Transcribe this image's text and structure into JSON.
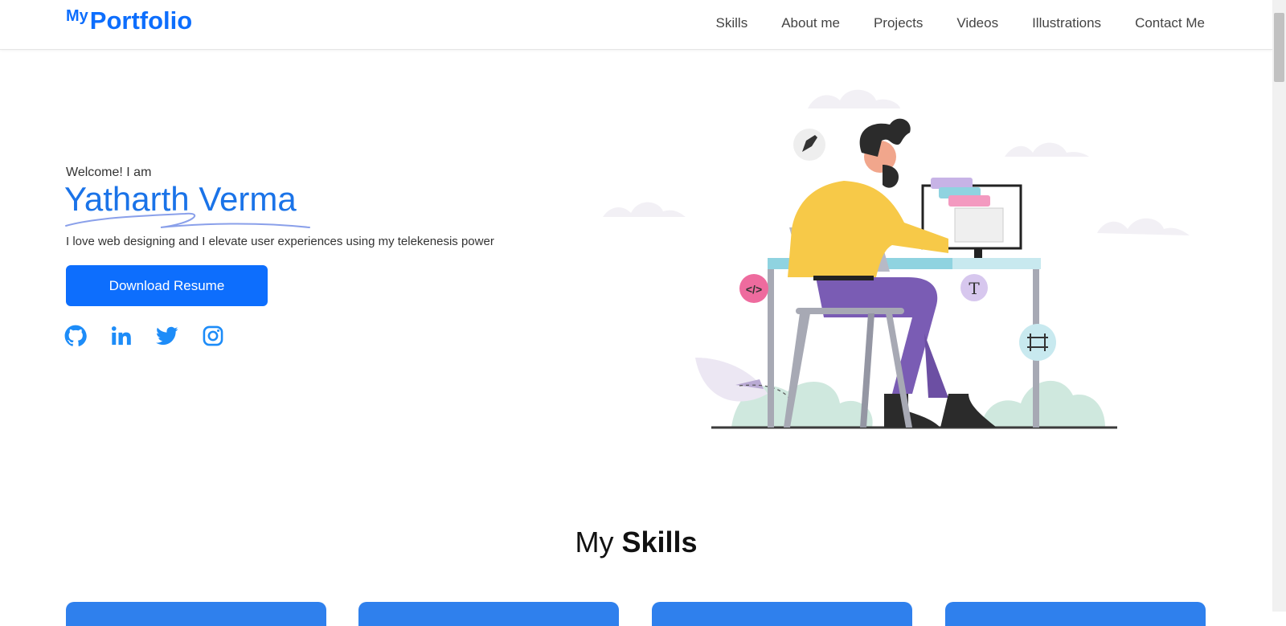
{
  "nav": {
    "logo_small": "My",
    "logo_big": "Portfolio",
    "links": [
      "Skills",
      "About me",
      "Projects",
      "Videos",
      "Illustrations",
      "Contact Me"
    ]
  },
  "hero": {
    "welcome": "Welcome! I am",
    "name": "Yatharth Verma",
    "tagline": "I love web designing and I elevate user experiences using my telekenesis power",
    "download_label": "Download Resume",
    "social_icons": [
      "github-icon",
      "linkedin-icon",
      "twitter-icon",
      "instagram-icon"
    ]
  },
  "skills": {
    "title_light": "My",
    "title_bold": "Skills"
  },
  "colors": {
    "accent": "#0d6efd",
    "name_blue": "#1a73e8",
    "social_blue": "#1d8cf8",
    "card_blue": "#2f80ed"
  }
}
